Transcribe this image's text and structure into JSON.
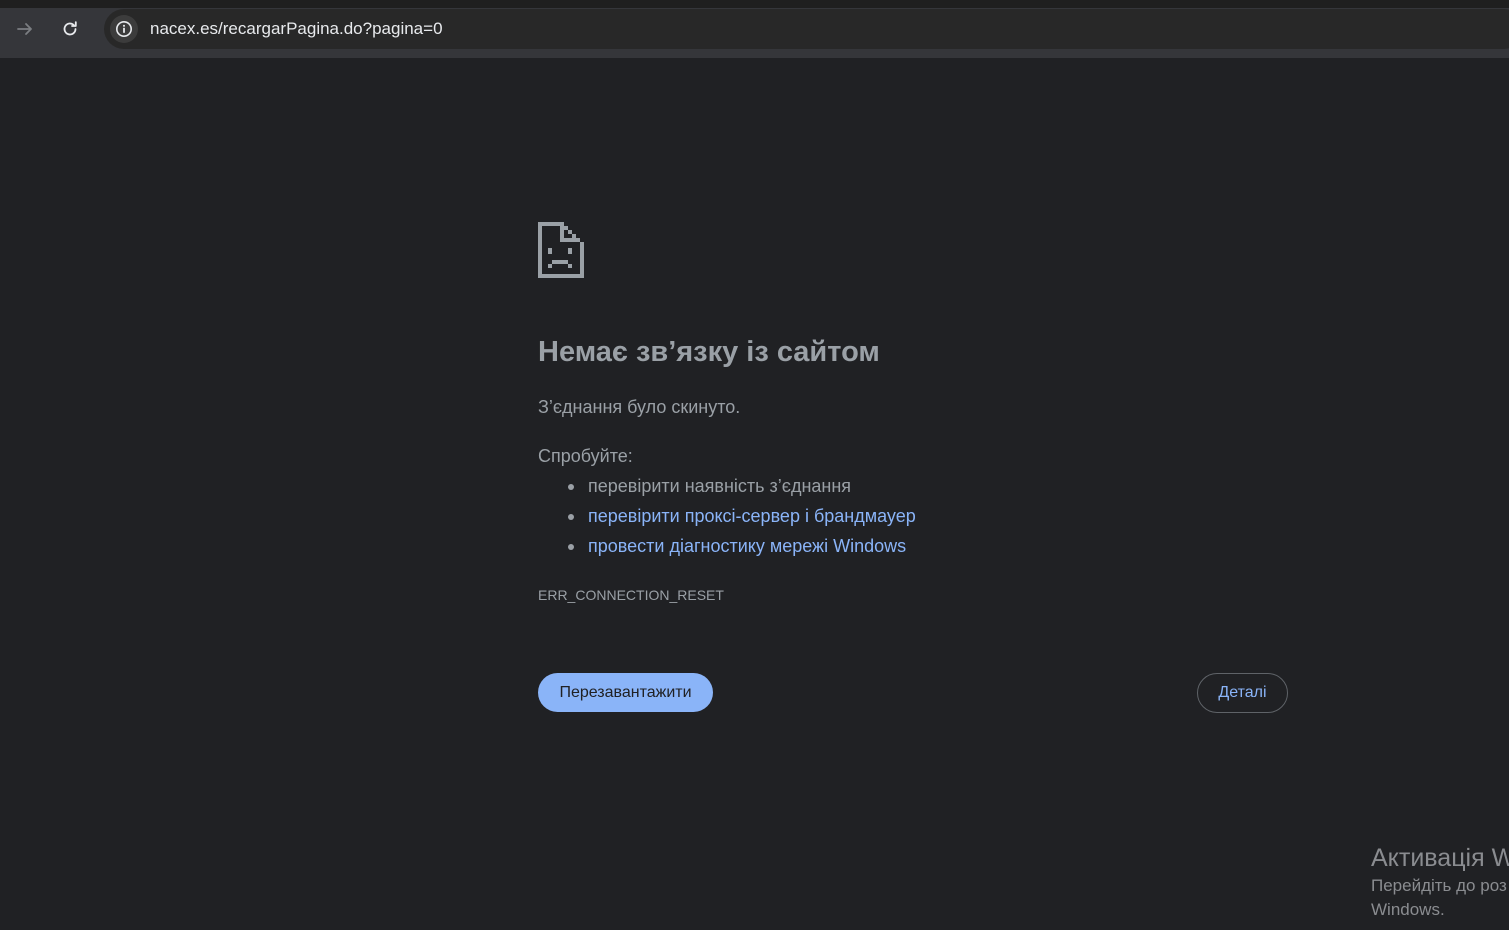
{
  "browser": {
    "url": "nacex.es/recargarPagina.do?pagina=0",
    "icons": {
      "forward": "arrow-right-icon",
      "reload": "reload-icon",
      "site_info": "info-icon"
    }
  },
  "error_page": {
    "icon": "sad-page-icon",
    "title": "Немає зв’язку із сайтом",
    "subtitle": "З’єднання було скинуто.",
    "try_label": "Спробуйте:",
    "suggestions": [
      {
        "text": "перевірити наявність з’єднання",
        "is_link": false
      },
      {
        "text": "перевірити проксі-сервер і брандмауер",
        "is_link": true
      },
      {
        "text": "провести діагностику мережі Windows",
        "is_link": true
      }
    ],
    "error_code": "ERR_CONNECTION_RESET",
    "reload_button": "Перезавантажити",
    "details_button": "Деталі"
  },
  "windows_activation": {
    "title": "Активація W",
    "line1": "Перейдіть до роз",
    "line2": "Windows."
  },
  "colors": {
    "background": "#202124",
    "toolbar": "#35363a",
    "text_muted": "#9aa0a6",
    "link": "#8ab4f8",
    "primary_button": "#8ab4f8"
  }
}
